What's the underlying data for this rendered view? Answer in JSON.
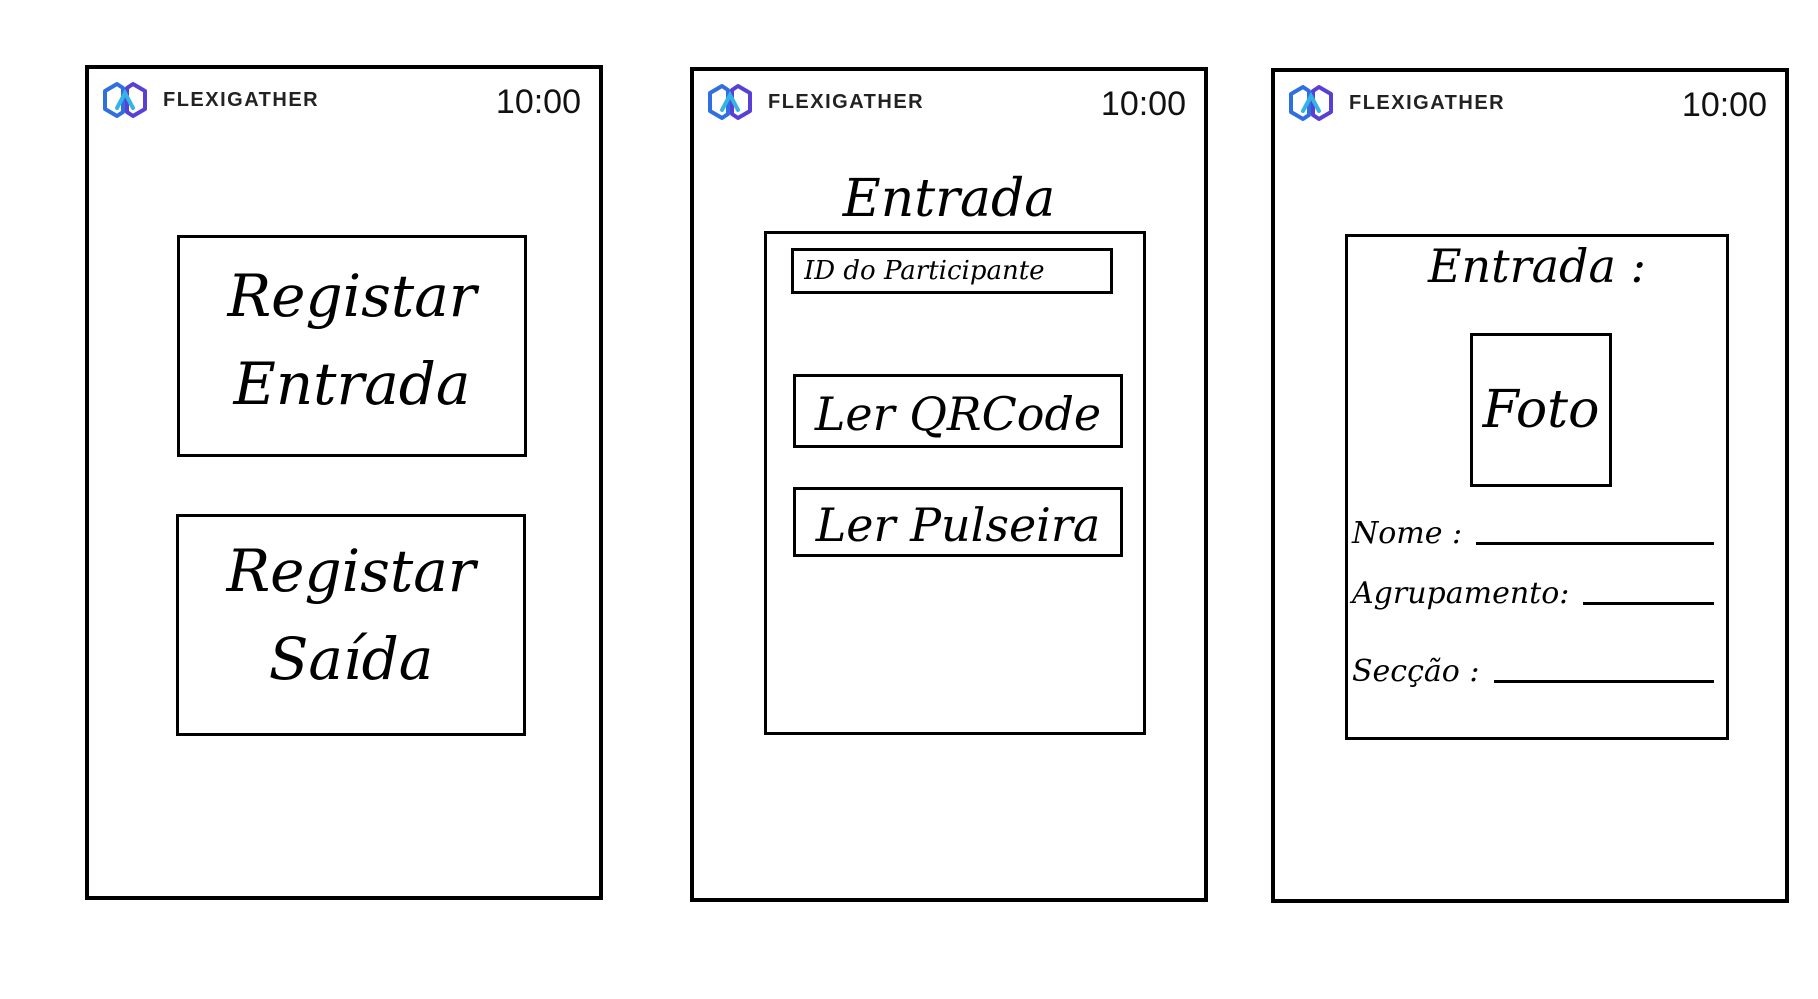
{
  "app": {
    "brand_name": "FLEXIGATHER",
    "time": "10:00",
    "accent_colors": [
      "#2f6fe0",
      "#35b3e6",
      "#5a3fd6"
    ]
  },
  "screen1": {
    "entry_button": {
      "line1": "Registar",
      "line2": "Entrada"
    },
    "exit_button": {
      "line1": "Registar",
      "line2": "Saída"
    }
  },
  "screen2": {
    "title": "Entrada",
    "participant_id_placeholder": "ID do Participante",
    "read_qr_label": "Ler QRCode",
    "read_bracelet_label": "Ler Pulseira"
  },
  "screen3": {
    "title": "Entrada :",
    "photo_label": "Foto",
    "name_label": "Nome :",
    "group_label": "Agrupamento:",
    "section_label": "Secção :"
  }
}
